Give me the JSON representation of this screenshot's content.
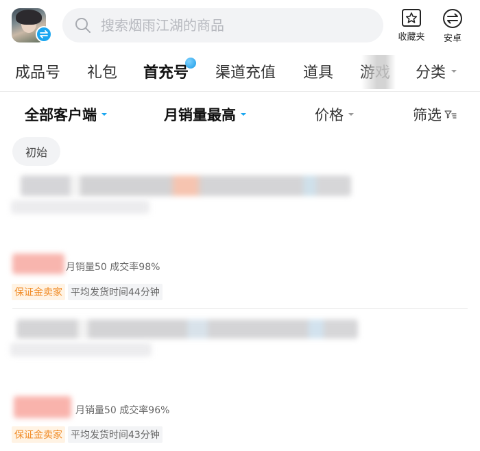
{
  "header": {
    "search_placeholder": "搜索烟雨江湖的商品",
    "favorites_label": "收藏夹",
    "platform_label": "安卓"
  },
  "category_tabs": [
    {
      "label": "成品号",
      "active": false
    },
    {
      "label": "礼包",
      "active": false
    },
    {
      "label": "首充号",
      "active": true
    },
    {
      "label": "渠道充值",
      "active": false
    },
    {
      "label": "道具",
      "active": false
    },
    {
      "label": "游戏",
      "active": false
    },
    {
      "label": "分类",
      "active": false
    }
  ],
  "filters": {
    "client": "全部客户端",
    "sort": "月销量最高",
    "price": "价格",
    "screen": "筛选"
  },
  "chip": "初始",
  "listings": [
    {
      "monthly_sales": "月销量50",
      "deal_rate": "成交率98%",
      "seller_tag": "保证金卖家",
      "shipping_time": "平均发货时间44分钟"
    },
    {
      "monthly_sales": "月销量50",
      "deal_rate": "成交率96%",
      "seller_tag": "保证金卖家",
      "shipping_time": "平均发货时间43分钟"
    }
  ],
  "colors": {
    "accent": "#1aa6f0",
    "seller_tag": "#f08a24",
    "search_bg": "#f2f3f5"
  },
  "icons": {
    "search": "search-icon",
    "favorites": "star-box-icon",
    "platform": "swap-circle-icon",
    "filter": "funnel-icon"
  }
}
